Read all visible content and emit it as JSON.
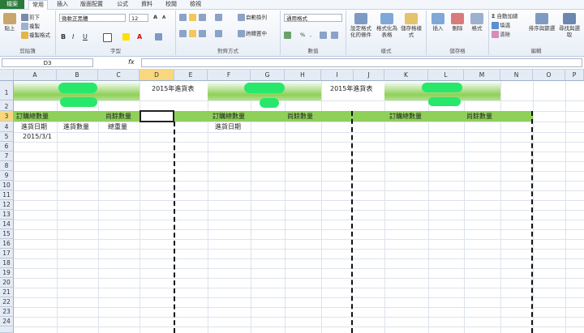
{
  "menu": {
    "tabs": [
      "檔案",
      "常用",
      "插入",
      "版面配置",
      "公式",
      "資料",
      "校閱",
      "檢視"
    ]
  },
  "ribbon": {
    "clipboard": {
      "paste": "貼上",
      "cut": "剪下",
      "copy": "複製",
      "format_painter": "複製格式",
      "label": "剪貼簿"
    },
    "font": {
      "name": "微軟正黑體",
      "size": "12",
      "label": "字型",
      "grow": "A",
      "shrink": "A",
      "bold": "B",
      "italic": "I",
      "underline": "U"
    },
    "alignment": {
      "wrap": "自動換列",
      "merge": "跨欄置中",
      "label": "對齊方式"
    },
    "number": {
      "format": "通用格式",
      "percent": "%",
      "comma": ",",
      "label": "數值"
    },
    "styles": {
      "conditional": "設定格式化的條件",
      "as_table": "格式化為表格",
      "cell_styles": "儲存格樣式",
      "label": "樣式"
    },
    "cells": {
      "insert": "插入",
      "delete": "刪除",
      "format": "格式",
      "label": "儲存格"
    },
    "editing": {
      "autosum": "自動加總",
      "fill": "填滿",
      "clear": "清除",
      "sort": "排序與篩選",
      "find": "尋找與選取",
      "label": "編輯"
    }
  },
  "formula_bar": {
    "name_box": "D3",
    "fx": "fx",
    "value": ""
  },
  "columns": [
    "A",
    "B",
    "C",
    "D",
    "E",
    "F",
    "G",
    "H",
    "I",
    "J",
    "K",
    "L",
    "M",
    "N",
    "O",
    "P"
  ],
  "rows": [
    "1",
    "2",
    "3",
    "4",
    "5",
    "6",
    "7",
    "8",
    "9",
    "10",
    "11",
    "12",
    "13",
    "14",
    "15",
    "16",
    "17",
    "18",
    "19",
    "20",
    "21",
    "22",
    "23",
    "24"
  ],
  "cells": {
    "d1": "2015年進貨表",
    "i1": "2015年進貨表",
    "a3": "訂購總數量",
    "c3": "尚餘數量",
    "f3": "訂購總數量",
    "h3": "尚餘數量",
    "k3": "訂購總數量",
    "m3": "尚餘數量",
    "a4": "進貨日期",
    "b4": "進貨數量",
    "c4": "總重量",
    "f4": "進貨日期",
    "a5": "2015/3/1"
  },
  "colors": {
    "accent_green": "#8fd05a",
    "file_tab": "#2a7a3b",
    "selection": "#f9d77e"
  }
}
